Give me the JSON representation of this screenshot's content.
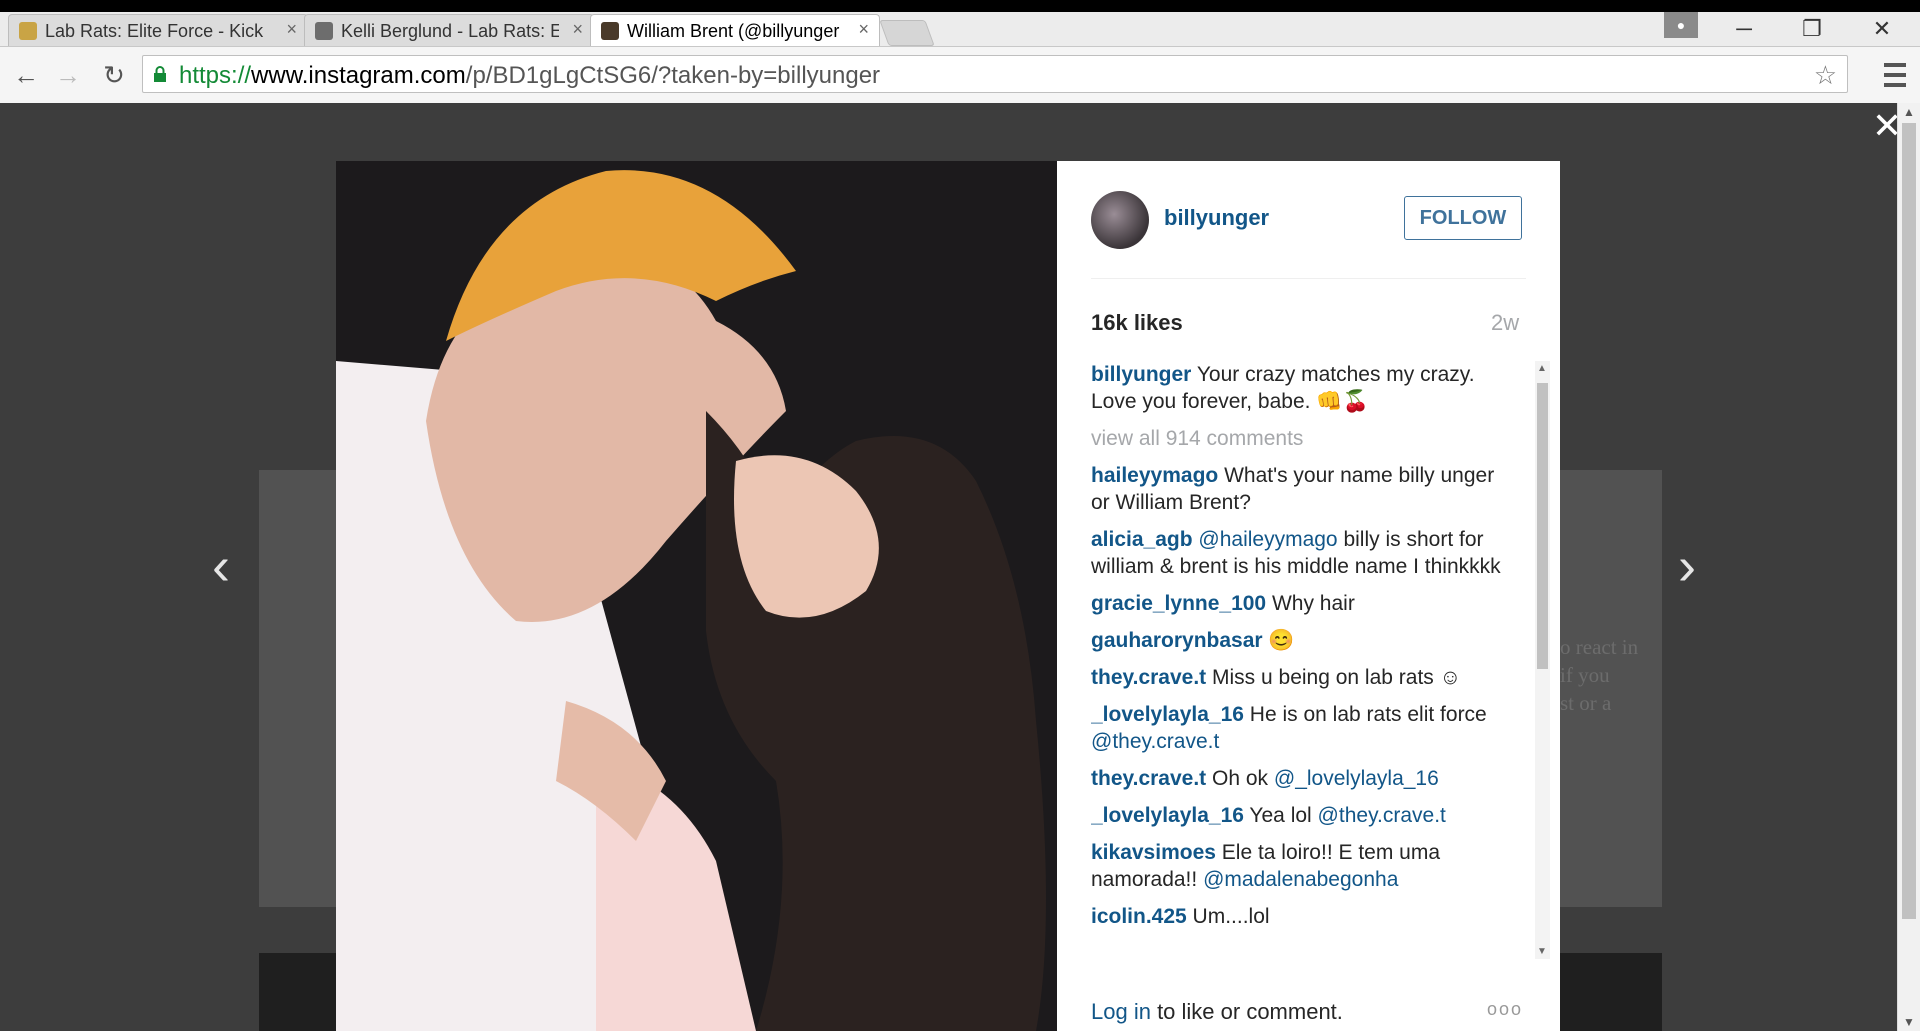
{
  "browser": {
    "tabs": [
      {
        "title": "Lab Rats: Elite Force - Kick",
        "close": "×",
        "favicon_color": "#c9a445"
      },
      {
        "title": "Kelli Berglund - Lab Rats: E",
        "close": "×",
        "favicon_color": "#6d6d6d"
      },
      {
        "title": "William Brent (@billyunger",
        "close": "×",
        "favicon_color": "#4a3a2a",
        "active": true
      }
    ],
    "window": {
      "minimize": "─",
      "restore": "❐",
      "close": "✕"
    },
    "nav": {
      "back": "←",
      "forward": "→",
      "reload": "↻"
    },
    "url": {
      "scheme": "https://",
      "host": "www.instagram.com",
      "path": "/p/BD1gLgCtSG6/?taken-by=billyunger"
    },
    "bookmark": "☆"
  },
  "overlay": {
    "close": "✕",
    "prev": "‹",
    "next": "›",
    "background_text": [
      "o react in",
      "if you",
      "st or a"
    ]
  },
  "post": {
    "username": "billyunger",
    "follow_label": "FOLLOW",
    "likes": "16k likes",
    "age": "2w",
    "caption": {
      "user": "billyunger",
      "text": " Your crazy matches my crazy. Love you forever, babe. 👊🍒"
    },
    "view_all": "view all 914 comments",
    "comments": [
      {
        "user": "haileyymago",
        "text": " What's your name billy unger or William Brent?"
      },
      {
        "user": "alicia_agb",
        "mention": " @haileyymago",
        "text": " billy is short for william & brent is his middle name I thinkkkk"
      },
      {
        "user": "gracie_lynne_100",
        "text": " Why hair"
      },
      {
        "user": "gauharorynbasar",
        "text": " 😊"
      },
      {
        "user": "they.crave.t",
        "text": " Miss u being on lab rats ☺"
      },
      {
        "user": "_lovelylayla_16",
        "text": " He is on lab rats elit force",
        "mention": " @they.crave.t"
      },
      {
        "user": "they.crave.t",
        "text": " Oh ok",
        "mention": " @_lovelylayla_16"
      },
      {
        "user": "_lovelylayla_16",
        "text": " Yea lol",
        "mention": " @they.crave.t"
      },
      {
        "user": "kikavsimoes",
        "text": " Ele ta loiro!! E tem uma namorada!!",
        "mention": " @madalenabegonha"
      },
      {
        "user": "icolin.425",
        "text": " Um....lol"
      }
    ],
    "login_link": "Log in",
    "login_rest": " to like or comment.",
    "more": "ooo"
  },
  "colors": {
    "link": "#125688",
    "follow": "#3f729b",
    "secure": "#138a36"
  }
}
